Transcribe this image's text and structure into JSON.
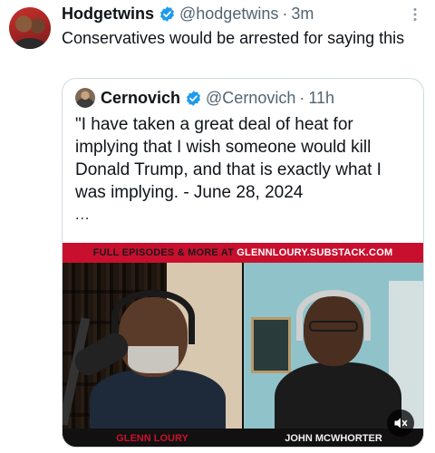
{
  "tweet": {
    "author_name": "Hodgetwins",
    "author_handle": "@hodgetwins",
    "separator": "·",
    "time": "3m",
    "text": "Conservatives would be arrested for saying this"
  },
  "quoted_tweet": {
    "author_name": "Cernovich",
    "author_handle": "@Cernovich",
    "separator": "·",
    "time": "11h",
    "text": "\"I have taken a great deal of heat for implying that I wish someone would kill Donald Trump, and that is exactly what I was implying. - June 28, 2024",
    "ellipsis": "...",
    "media": {
      "banner_prefix": "FULL EPISODES & MORE AT ",
      "banner_url": "GLENNLOURY.SUBSTACK.COM",
      "caption_left": "GLENN LOURY",
      "caption_right": "JOHN MCWHORTER",
      "mute_icon": "speaker-muted-icon"
    }
  },
  "colors": {
    "verified_blue": "#1d9bf0",
    "banner_red": "#c8102e",
    "secondary_text": "#536471"
  }
}
